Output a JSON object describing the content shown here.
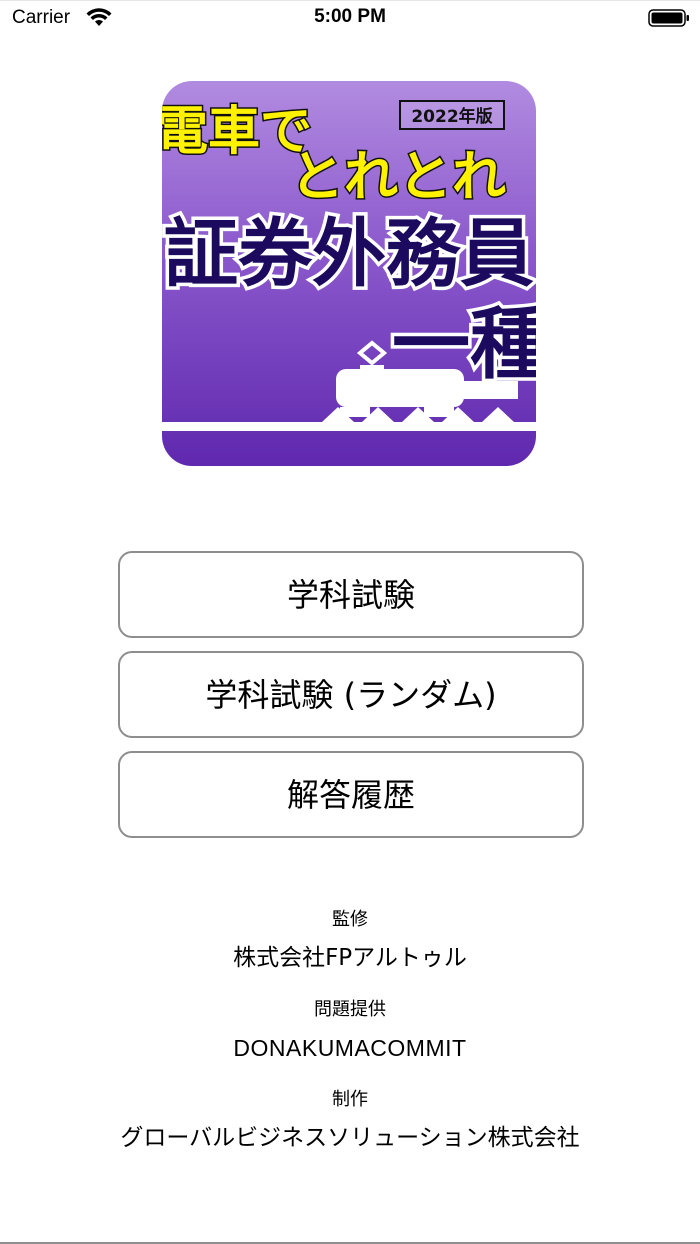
{
  "status_bar": {
    "carrier": "Carrier",
    "time": "5:00 PM"
  },
  "app_icon": {
    "line1": "電車で",
    "line2": "とれとれ",
    "edition": "2022年版",
    "title": "証券外務員",
    "subtitle": "一種",
    "colors": {
      "top": "#a277d6",
      "bottom": "#6a31b8",
      "title_fill": "#1c0a5e",
      "yellow": "#fff200"
    }
  },
  "menu": {
    "buttons": [
      {
        "label": "学科試験"
      },
      {
        "label": "学科試験 (ランダム)"
      },
      {
        "label": "解答履歴"
      }
    ]
  },
  "credits": {
    "supervision_heading": "監修",
    "supervision_value": "株式会社FPアルトゥル",
    "questions_heading": "問題提供",
    "questions_value": "DONAKUMACOMMIT",
    "production_heading": "制作",
    "production_value": "グローバルビジネスソリューション株式会社"
  }
}
